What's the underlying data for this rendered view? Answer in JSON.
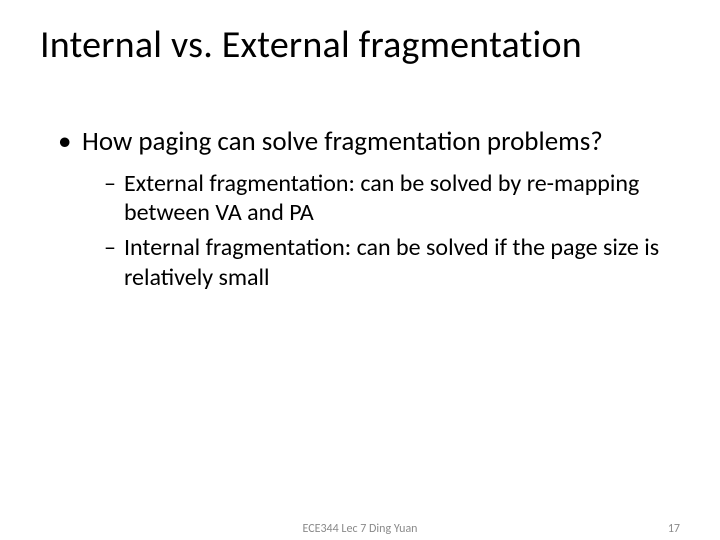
{
  "title": "Internal vs. External fragmentation",
  "bullets": [
    {
      "text": "How paging can solve fragmentation problems?",
      "children": [
        {
          "label": "External fragmentation",
          "rest": ": can be solved by re-mapping between VA and PA"
        },
        {
          "label": "Internal fragmentation",
          "rest": ": can be solved if the page size is relatively small"
        }
      ]
    }
  ],
  "footer": {
    "center": "ECE344 Lec 7 Ding Yuan",
    "page": "17"
  }
}
